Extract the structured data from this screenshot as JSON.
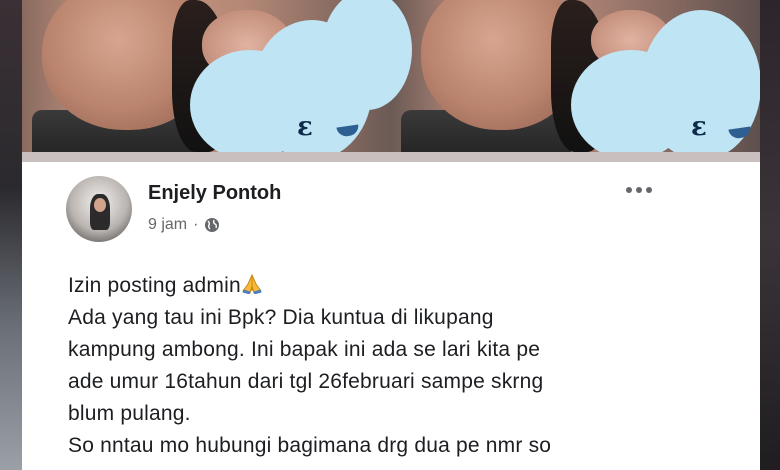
{
  "post": {
    "author": "Enjely Pontoh",
    "time": "9 jam",
    "separator": "·",
    "lines": [
      "Izin posting admin",
      "Ada yang tau ini Bpk? Dia kuntua di likupang",
      "kampung ambong. Ini bapak ini ada se lari kita pe",
      "ade umur 16tahun dari tgl 26februari sampe skrng",
      "blum pulang.",
      "So nntau mo hubungi bagimana drg dua pe nmr so"
    ]
  },
  "icons": {
    "avatar": "avatar",
    "globe": "globe-icon",
    "more": "more-options-icon",
    "pray": "pray-emoji-icon"
  },
  "colors": {
    "name": "#1c1e21",
    "meta": "#65676b",
    "blur_overlay": "#bfe4f3"
  }
}
